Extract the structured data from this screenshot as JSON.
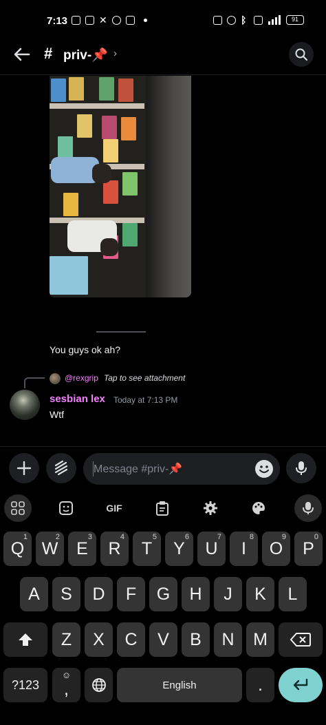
{
  "status_bar": {
    "time": "7:13",
    "battery": "91",
    "left_icons": [
      "instagram-icon",
      "hd-icon",
      "x-icon",
      "app-icon",
      "mail-icon"
    ],
    "right_icons": [
      "nfc-icon",
      "alarm-icon",
      "bluetooth-icon",
      "vibrate-icon",
      "signal-icon"
    ]
  },
  "header": {
    "channel_name": "priv-📌",
    "channel_icon": "hash-threads-icon",
    "chevron": "›"
  },
  "chat": {
    "message_1": "You guys ok ah?",
    "reply": {
      "user": "@rexgrip",
      "text": "Tap to see attachment"
    },
    "message_2": {
      "author": "sesbian lex",
      "timestamp": "Today at 7:13 PM",
      "text": "Wtf"
    }
  },
  "composer": {
    "placeholder": "Message #priv-📌"
  },
  "keyboard": {
    "toolbar": [
      "apps-icon",
      "sticker-icon",
      "GIF",
      "clipboard-icon",
      "settings-icon",
      "palette-icon",
      "mic-icon"
    ],
    "row1": [
      {
        "key": "Q",
        "hint": "1"
      },
      {
        "key": "W",
        "hint": "2"
      },
      {
        "key": "E",
        "hint": "3"
      },
      {
        "key": "R",
        "hint": "4"
      },
      {
        "key": "T",
        "hint": "5"
      },
      {
        "key": "Y",
        "hint": "6"
      },
      {
        "key": "U",
        "hint": "7"
      },
      {
        "key": "I",
        "hint": "8"
      },
      {
        "key": "O",
        "hint": "9"
      },
      {
        "key": "P",
        "hint": "0"
      }
    ],
    "row2": [
      "A",
      "S",
      "D",
      "F",
      "G",
      "H",
      "J",
      "K",
      "L"
    ],
    "row3": [
      "Z",
      "X",
      "C",
      "V",
      "B",
      "N",
      "M"
    ],
    "symbols_label": "?123",
    "comma": ",",
    "space_label": "English",
    "period": "."
  },
  "colors": {
    "background": "#000000",
    "username_pink": "#f47fff",
    "enter_key": "#7fd2d0",
    "accent": "#5865f2"
  }
}
